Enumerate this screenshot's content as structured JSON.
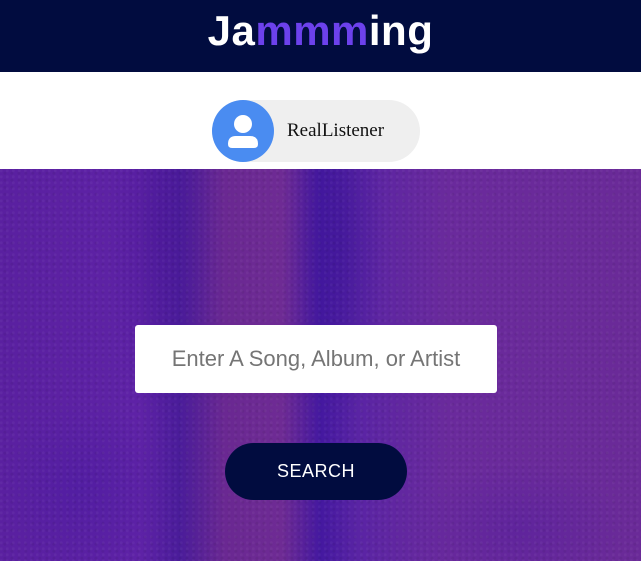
{
  "app": {
    "logo_part1": "Ja",
    "logo_accent": "mmm",
    "logo_part2": "ing"
  },
  "user": {
    "name": "RealListener",
    "avatar_icon": "user-icon"
  },
  "search": {
    "placeholder": "Enter A Song, Album, or Artist",
    "value": "",
    "button_label": "SEARCH"
  },
  "colors": {
    "header_bg": "#010c3f",
    "logo_accent": "#6c41ec",
    "avatar_bg": "#4a8cf1",
    "pill_bg": "#efefef",
    "hero_bg": "#5e22a6",
    "button_bg": "#010c3f"
  }
}
